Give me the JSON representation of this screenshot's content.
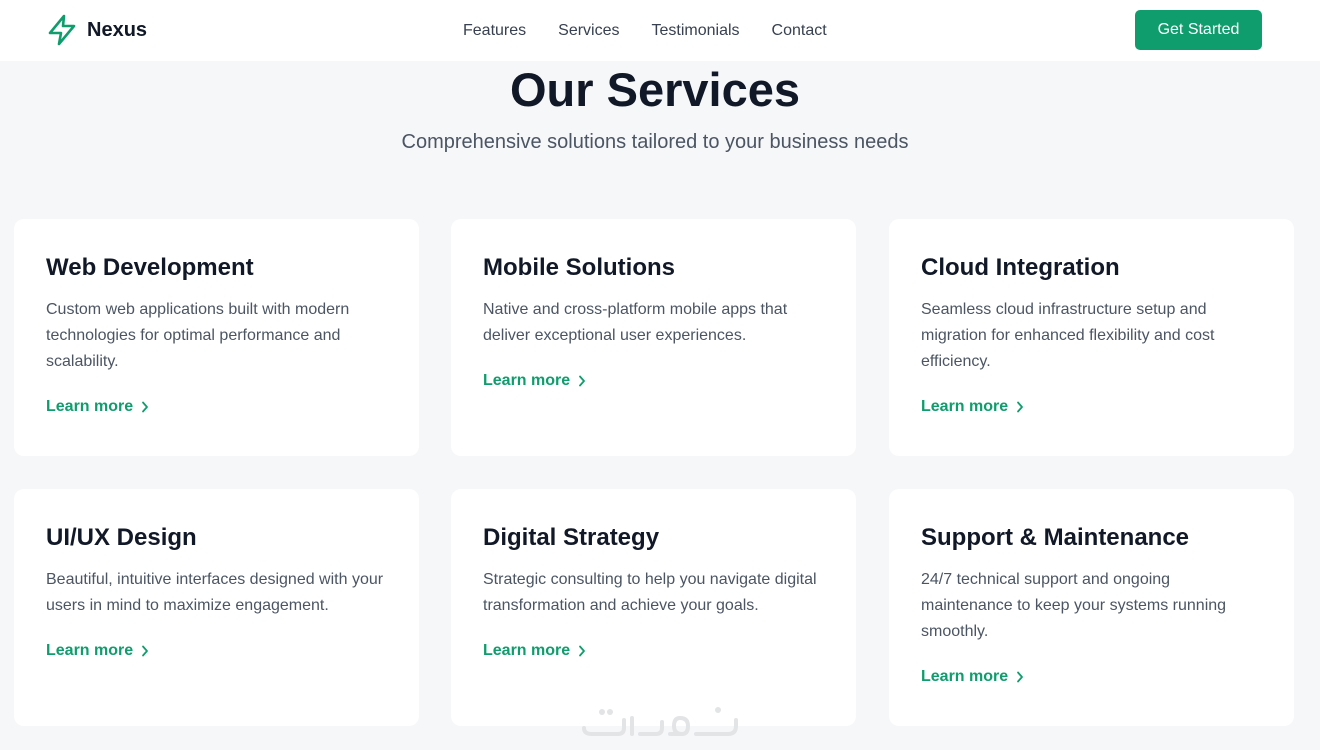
{
  "brand": {
    "name": "Nexus",
    "accent_color": "#0f9d6e",
    "logo_icon": "lightning-bolt-icon"
  },
  "nav": {
    "links": [
      "Features",
      "Services",
      "Testimonials",
      "Contact"
    ],
    "cta_label": "Get Started"
  },
  "header": {
    "title": "Our Services",
    "subtitle": "Comprehensive solutions tailored to your business needs"
  },
  "services": [
    {
      "title": "Web Development",
      "description": "Custom web applications built with modern technologies for optimal performance and scalability.",
      "link_label": "Learn more"
    },
    {
      "title": "Mobile Solutions",
      "description": "Native and cross-platform mobile apps that deliver exceptional user experiences.",
      "link_label": "Learn more"
    },
    {
      "title": "Cloud Integration",
      "description": "Seamless cloud infrastructure setup and migration for enhanced flexibility and cost efficiency.",
      "link_label": "Learn more"
    },
    {
      "title": "UI/UX Design",
      "description": "Beautiful, intuitive interfaces designed with your users in mind to maximize engagement.",
      "link_label": "Learn more"
    },
    {
      "title": "Digital Strategy",
      "description": "Strategic consulting to help you navigate digital transformation and achieve your goals.",
      "link_label": "Learn more"
    },
    {
      "title": "Support & Maintenance",
      "description": "24/7 technical support and ongoing maintenance to keep your systems running smoothly.",
      "link_label": "Learn more"
    }
  ],
  "watermark_icon": "khamsat-watermark-logo"
}
